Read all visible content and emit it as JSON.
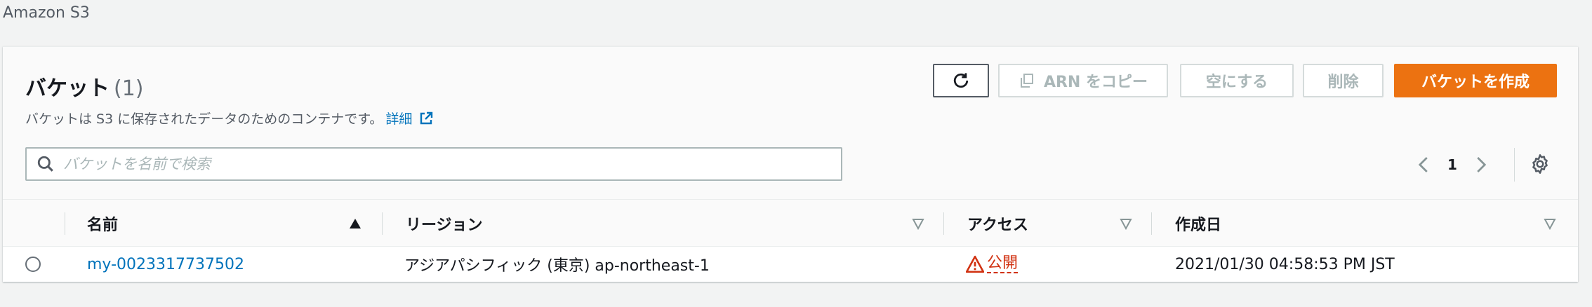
{
  "breadcrumb": {
    "service": "Amazon S3"
  },
  "header": {
    "title": "バケット",
    "count": "(1)",
    "description": "バケットは S3 に保存されたデータのためのコンテナです。",
    "details_link": "詳細"
  },
  "toolbar": {
    "refresh_icon": "refresh-icon",
    "copy_arn_label": "ARN をコピー",
    "empty_label": "空にする",
    "delete_label": "削除",
    "create_label": "バケットを作成"
  },
  "search": {
    "placeholder": "バケットを名前で検索",
    "value": ""
  },
  "pagination": {
    "current_page": "1"
  },
  "table": {
    "columns": [
      {
        "label": "名前",
        "sort": "ascending"
      },
      {
        "label": "リージョン",
        "sort": "none"
      },
      {
        "label": "アクセス",
        "sort": "none"
      },
      {
        "label": "作成日",
        "sort": "none"
      }
    ],
    "rows": [
      {
        "name": "my-0023317737502",
        "region": "アジアパシフィック (東京) ap-northeast-1",
        "access": "公開",
        "created": "2021/01/30 04:58:53 PM JST"
      }
    ]
  },
  "colors": {
    "primary": "#ec7211",
    "link": "#0073bb",
    "warning": "#d13212"
  }
}
